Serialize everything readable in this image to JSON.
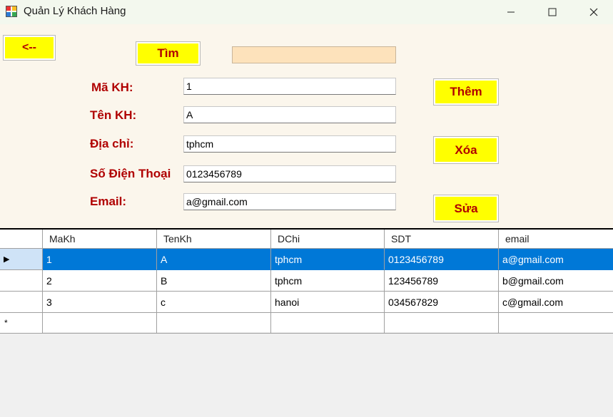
{
  "window": {
    "title": "Quản Lý Khách Hàng",
    "controls": {
      "minimize": "—",
      "maximize": "☐",
      "close": "✕"
    }
  },
  "toolbar": {
    "back_label": "<--",
    "search_label": "Tìm",
    "search_value": ""
  },
  "form": {
    "labels": {
      "makh": "Mã KH:",
      "tenkh": "Tên KH:",
      "diachi": "Địa chỉ:",
      "sdt": "Số Điện Thoại",
      "email": "Email:"
    },
    "values": {
      "makh": "1",
      "tenkh": "A",
      "diachi": "tphcm",
      "sdt": "0123456789",
      "email": "a@gmail.com"
    }
  },
  "actions": {
    "add": "Thêm",
    "delete": "Xóa",
    "edit": "Sửa"
  },
  "grid": {
    "columns": [
      "MaKh",
      "TenKh",
      "DChi",
      "SDT",
      "email"
    ],
    "rows": [
      [
        "1",
        "A",
        "tphcm",
        "0123456789",
        "a@gmail.com"
      ],
      [
        "2",
        "B",
        "tphcm",
        "123456789",
        "b@gmail.com"
      ],
      [
        "3",
        "c",
        "hanoi",
        "034567829",
        "c@gmail.com"
      ]
    ],
    "selected_row_marker": "▸",
    "new_row_marker": "*"
  },
  "colors": {
    "form_background": "#fbf6ec",
    "button_background": "#ffff00",
    "label_color": "#b00000",
    "selection": "#0078d7",
    "search_box": "#fde2bb"
  }
}
